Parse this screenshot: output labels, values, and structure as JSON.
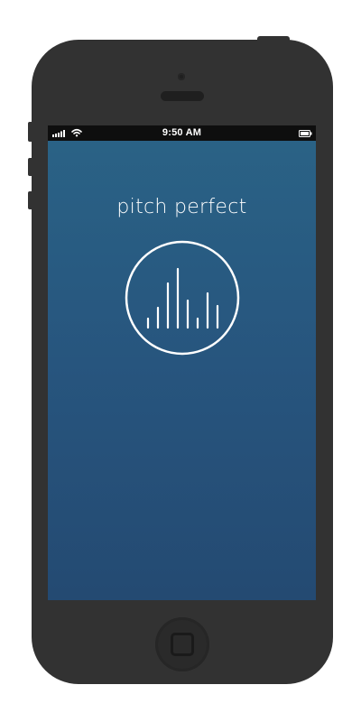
{
  "device": {
    "body_color": "#323232",
    "screen_gradient_top": "#2a6386",
    "screen_gradient_bottom": "#244a72"
  },
  "status_bar": {
    "time": "9:50 AM",
    "signal_icon": "signal-bars-icon",
    "wifi_icon": "wifi-icon",
    "battery_icon": "battery-icon"
  },
  "app": {
    "title": "pitch perfect",
    "record_button_icon": "audio-waveform-icon"
  },
  "home_button": {
    "icon": "home-square-icon"
  }
}
